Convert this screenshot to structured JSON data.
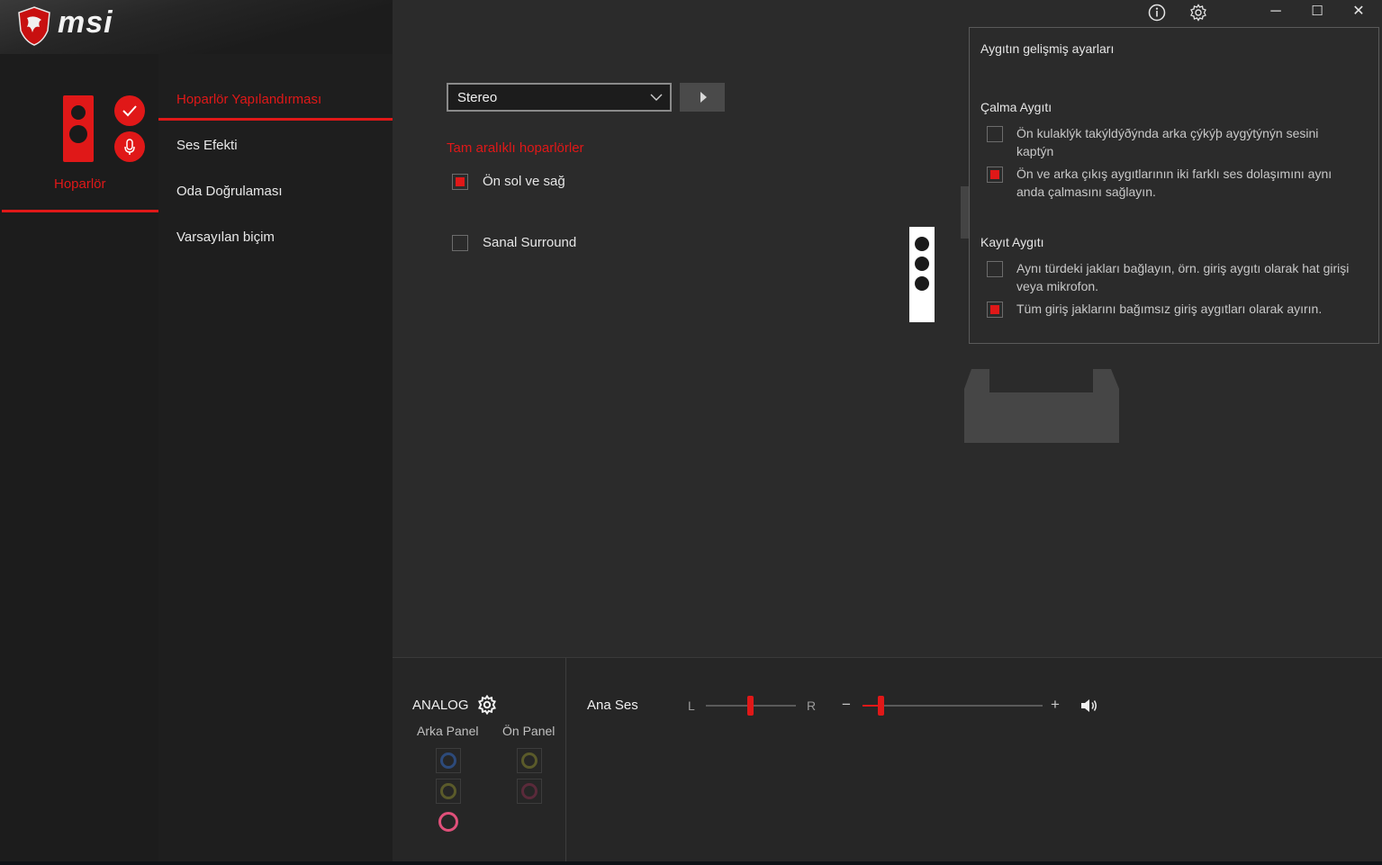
{
  "brand": {
    "name": "msi"
  },
  "window": {
    "info_icon": "info-icon",
    "settings_icon": "gear-icon",
    "minimize": "─",
    "maximize": "☐",
    "close": "✕"
  },
  "device": {
    "label": "Hoparlör"
  },
  "nav": {
    "items": [
      {
        "label": "Hoparlör Yapılandırması",
        "active": true
      },
      {
        "label": "Ses Efekti"
      },
      {
        "label": "Oda Doğrulaması"
      },
      {
        "label": "Varsayılan biçim"
      }
    ]
  },
  "config": {
    "select_value": "Stereo",
    "section_title": "Tam aralıklı hoparlörler",
    "options": [
      {
        "label": "Ön sol ve sağ",
        "checked": true
      },
      {
        "label": "Sanal Surround",
        "checked": false
      }
    ]
  },
  "popup": {
    "title": "Aygıtın gelişmiş ayarları",
    "playback": {
      "title": "Çalma Aygıtı",
      "options": [
        {
          "label": "Ön kulaklýk takýldýðýnda arka çýkýþ aygýtýnýn sesini kaptýn",
          "checked": false
        },
        {
          "label": "Ön ve arka çıkış aygıtlarının iki farklı ses dolaşımını aynı anda çalmasını sağlayın.",
          "checked": true
        }
      ]
    },
    "recording": {
      "title": "Kayıt Aygıtı",
      "options": [
        {
          "label": "Aynı türdeki jakları bağlayın, örn. giriş aygıtı olarak hat girişi veya mikrofon.",
          "checked": false
        },
        {
          "label": "Tüm giriş jaklarını bağımsız giriş aygıtları olarak ayırın.",
          "checked": true
        }
      ]
    }
  },
  "analog": {
    "title": "ANALOG",
    "rear_label": "Arka Panel",
    "front_label": "Ön Panel",
    "rear_jacks": [
      "#2d4a7a",
      "#5a5a2a",
      "#e0507a"
    ],
    "front_jacks": [
      "#5a5a2a",
      "#5a2a3a"
    ]
  },
  "volume": {
    "label": "Ana Ses",
    "balance_left": "L",
    "balance_right": "R",
    "minus": "−",
    "plus": "+",
    "balance_value": 0.5,
    "volume_value": 0.1
  },
  "colors": {
    "accent": "#e01818"
  }
}
